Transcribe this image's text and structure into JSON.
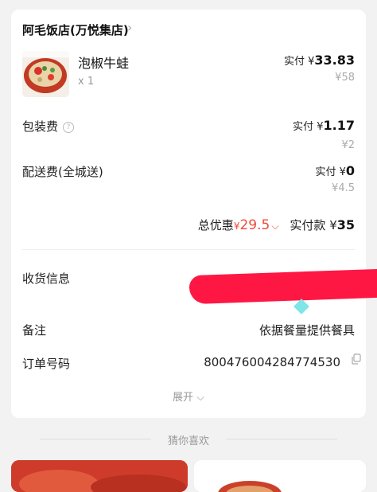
{
  "shop": {
    "name": "阿毛饭店(万悦集店)",
    "chevron": "›"
  },
  "item": {
    "name": "泡椒牛蛙",
    "qty": "x 1",
    "paid_prefix": "实付 ¥",
    "paid": "33.83",
    "original": "¥58"
  },
  "packing": {
    "label": "包装费",
    "help_icon": "?",
    "paid_prefix": "实付 ¥",
    "paid": "1.17",
    "original": "¥2"
  },
  "delivery": {
    "label": "配送费(全城送)",
    "paid_prefix": "实付 ¥",
    "paid": "0",
    "original": "¥4.5"
  },
  "summary": {
    "discount_label": "总优惠",
    "discount_currency": "¥",
    "discount_value": "29.5",
    "chevron": "⌵",
    "total_label": "实付款 ¥",
    "total_value": "35"
  },
  "info": {
    "address_label": "收货信息",
    "remark_label": "备注",
    "remark_value": "依据餐量提供餐具",
    "order_label": "订单号码",
    "order_value": "800476004284774530"
  },
  "expand": {
    "label": "展开",
    "chevron": "⌵"
  },
  "recommend": {
    "title": "猜你喜欢"
  },
  "colors": {
    "accent_red": "#f04a3a",
    "redaction": "#ff1744"
  }
}
